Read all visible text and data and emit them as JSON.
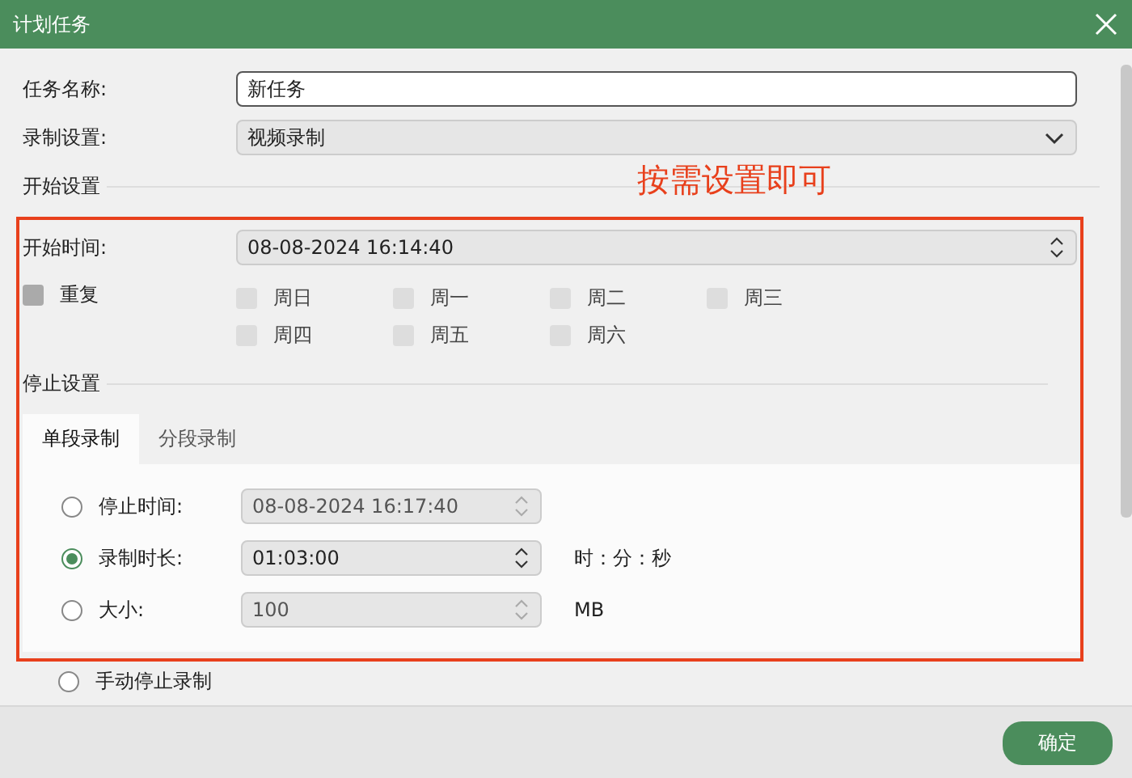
{
  "window": {
    "title": "计划任务"
  },
  "task_name": {
    "label": "任务名称:",
    "value": "新任务"
  },
  "recording": {
    "label": "录制设置:",
    "value": "视频录制"
  },
  "start_section": {
    "heading": "开始设置"
  },
  "annotation": "按需设置即可",
  "start_time": {
    "label": "开始时间:",
    "value": "08-08-2024 16:14:40"
  },
  "repeat": {
    "label": "重复",
    "checked": false
  },
  "weekdays": [
    {
      "label": "周日",
      "checked": false,
      "disabled": true
    },
    {
      "label": "周一",
      "checked": false,
      "disabled": true
    },
    {
      "label": "周二",
      "checked": false,
      "disabled": true
    },
    {
      "label": "周三",
      "checked": false,
      "disabled": true
    },
    {
      "label": "周四",
      "checked": false,
      "disabled": true
    },
    {
      "label": "周五",
      "checked": false,
      "disabled": true
    },
    {
      "label": "周六",
      "checked": false,
      "disabled": true
    }
  ],
  "stop_section": {
    "heading": "停止设置"
  },
  "tabs": [
    {
      "label": "单段录制",
      "selected": true
    },
    {
      "label": "分段录制",
      "selected": false
    }
  ],
  "stop_options": [
    {
      "kind": "field",
      "label": "停止时间:",
      "value": "08-08-2024 16:17:40",
      "selected": false
    },
    {
      "kind": "field",
      "label": "录制时长:",
      "value": "01:03:00",
      "unit": "时：分：秒",
      "selected": true
    },
    {
      "kind": "field",
      "label": "大小:",
      "value": "100",
      "unit": "MB",
      "selected": false
    },
    {
      "kind": "plain",
      "label": "手动停止录制",
      "selected": false
    }
  ],
  "confirm_button": "确定"
}
